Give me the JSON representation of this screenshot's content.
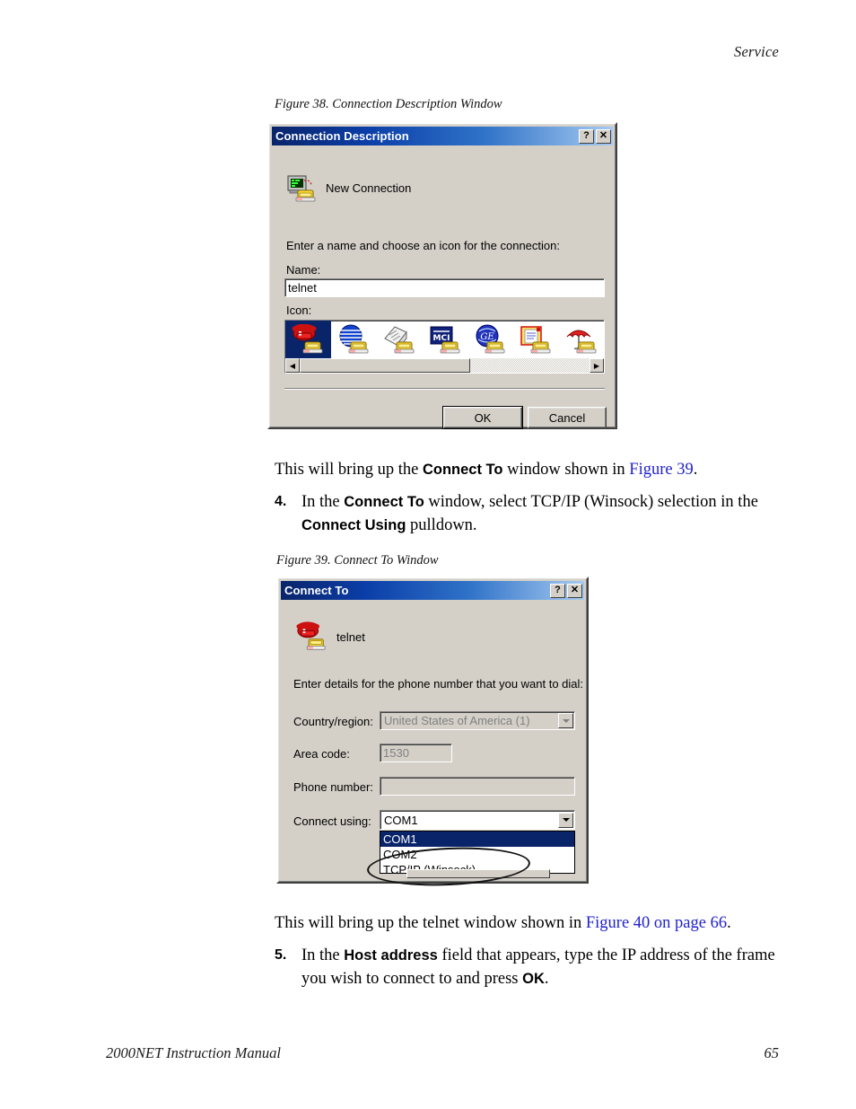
{
  "page": {
    "header_right": "Service",
    "footer_left": "2000NET Instruction Manual",
    "footer_page": "65"
  },
  "figure38": {
    "caption": "Figure 38.  Connection Description Window",
    "window": {
      "title": "Connection Description",
      "help_button": "?",
      "close_button": "✕",
      "connection_name": "New Connection",
      "instruction": "Enter a name and choose an icon for the connection:",
      "name_label": "Name:",
      "name_value": "telnet",
      "icon_label": "Icon:",
      "icons": [
        {
          "name": "red-telephone-icon",
          "selected": true
        },
        {
          "name": "blue-globe-icon",
          "selected": false
        },
        {
          "name": "fax-machine-icon",
          "selected": false
        },
        {
          "name": "mci-logo-icon",
          "selected": false
        },
        {
          "name": "ge-globe-icon",
          "selected": false
        },
        {
          "name": "documents-icon",
          "selected": false
        },
        {
          "name": "red-umbrella-icon",
          "selected": false
        }
      ],
      "scroll_left": "◀",
      "scroll_right": "▶",
      "ok_label": "OK",
      "cancel_label": "Cancel"
    }
  },
  "para1": {
    "before": "This will bring up the ",
    "bold1": "Connect To",
    "mid": " window shown in ",
    "link": "Figure 39",
    "after": "."
  },
  "step4": {
    "number": "4.",
    "t1": "In the ",
    "b1": "Connect To",
    "t2": " window, select TCP/IP (Winsock) selection in the ",
    "b2": "Connect Using",
    "t3": " pulldown."
  },
  "figure39": {
    "caption": "Figure 39.  Connect To Window",
    "window": {
      "title": "Connect To",
      "help_button": "?",
      "close_button": "✕",
      "connection_name": "telnet",
      "instruction": "Enter details for the phone number that you want to dial:",
      "fields": [
        {
          "label": "Country/region:",
          "value": "United States of America (1)",
          "type": "combo",
          "disabled": true
        },
        {
          "label": "Area code:",
          "value": "1530",
          "type": "text",
          "disabled": true
        },
        {
          "label": "Phone number:",
          "value": "",
          "type": "text",
          "disabled": false
        },
        {
          "label": "Connect using:",
          "value": "COM1",
          "type": "combo",
          "disabled": false
        }
      ],
      "dropdown_options": [
        {
          "label": "COM1",
          "selected": true
        },
        {
          "label": "COM2",
          "selected": false
        },
        {
          "label": "TCP/IP (Winsock)",
          "selected": false
        }
      ],
      "annotation": "ellipse-highlight-tcpip"
    }
  },
  "para2": {
    "before": "This will bring up the telnet window shown in ",
    "link": "Figure 40 on page 66",
    "after": "."
  },
  "step5": {
    "number": "5.",
    "t1": "In the ",
    "b1": "Host address",
    "t2": " field that appears, type the IP address of the frame you wish to connect to and press ",
    "b2": "OK",
    "t3": "."
  },
  "colors": {
    "dialog_face": "#d4d0c8",
    "titlebar_start": "#0a246a",
    "titlebar_end": "#a6caf0",
    "selection": "#0a246a",
    "link": "#2222cc"
  }
}
